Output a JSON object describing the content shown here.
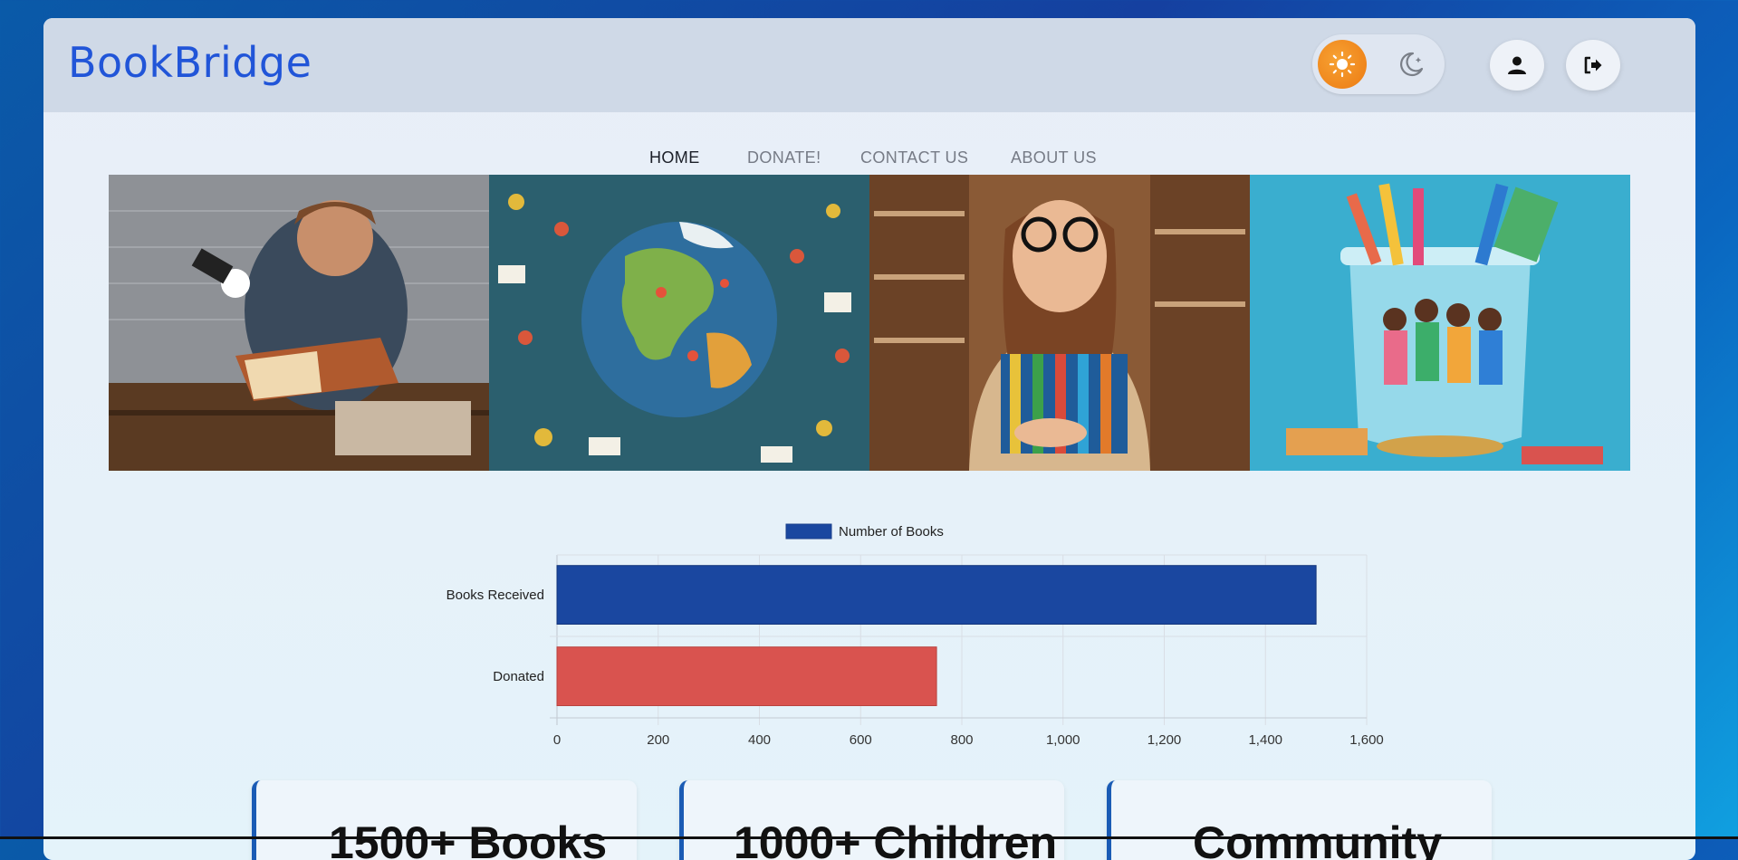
{
  "app": {
    "brand": "BookBridge"
  },
  "header": {
    "theme_light_icon": "sun-icon",
    "theme_dark_icon": "moon-icon",
    "profile_icon": "user-icon",
    "logout_icon": "logout-icon",
    "accent_color": "#ec7a12"
  },
  "nav": {
    "items": [
      {
        "label": "HOME",
        "active": true
      },
      {
        "label": "DONATE!",
        "active": false
      },
      {
        "label": "CONTACT US",
        "active": false
      },
      {
        "label": "ABOUT US",
        "active": false
      }
    ]
  },
  "banner": {
    "images": [
      "boy-reading-with-flashlight",
      "globe-with-children-learning",
      "girl-holding-books",
      "children-in-jar-with-pencils-and-money"
    ]
  },
  "chart_data": {
    "type": "bar",
    "orientation": "horizontal",
    "categories": [
      "Books Received",
      "Donated"
    ],
    "series": [
      {
        "name": "Number of Books",
        "values": [
          1500,
          750
        ],
        "colors": [
          "#1a47a0",
          "#d9534f"
        ]
      }
    ],
    "xlim": [
      0,
      1600
    ],
    "x_ticks": [
      "0",
      "200",
      "400",
      "600",
      "800",
      "1,000",
      "1,200",
      "1,400",
      "1,600"
    ],
    "legend_position": "top",
    "grid": true
  },
  "stats": [
    {
      "text": "1500+ Books"
    },
    {
      "text": "1000+ Children"
    },
    {
      "text": "Community"
    }
  ]
}
